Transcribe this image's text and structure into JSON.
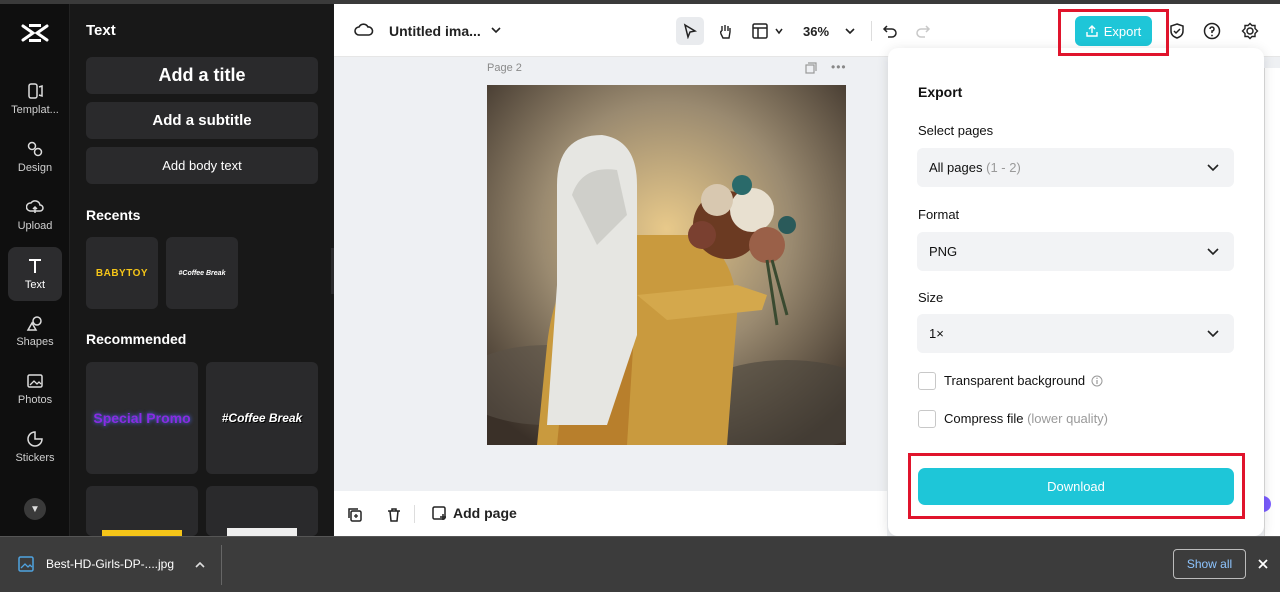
{
  "sidebar": {
    "items": [
      {
        "label": "Templat...",
        "icon": "template-icon"
      },
      {
        "label": "Design",
        "icon": "design-icon"
      },
      {
        "label": "Upload",
        "icon": "upload-icon"
      },
      {
        "label": "Text",
        "icon": "text-icon",
        "active": true
      },
      {
        "label": "Shapes",
        "icon": "shapes-icon"
      },
      {
        "label": "Photos",
        "icon": "photos-icon"
      },
      {
        "label": "Stickers",
        "icon": "stickers-icon"
      }
    ]
  },
  "panel": {
    "title": "Text",
    "add_title": "Add a title",
    "add_subtitle": "Add a subtitle",
    "add_body": "Add body text",
    "recents_label": "Recents",
    "recents": [
      "BABYTOY",
      "#Coffee Break"
    ],
    "recommended_label": "Recommended",
    "recommended": [
      "Special Promo",
      "#Coffee Break"
    ]
  },
  "toolbar": {
    "doc_title": "Untitled ima...",
    "zoom": "36%",
    "export_label": "Export"
  },
  "canvas": {
    "page_label": "Page 2"
  },
  "bottom": {
    "add_page": "Add page"
  },
  "export_panel": {
    "title": "Export",
    "select_pages_label": "Select pages",
    "select_pages_value": "All pages",
    "select_pages_range": "(1 - 2)",
    "format_label": "Format",
    "format_value": "PNG",
    "size_label": "Size",
    "size_value": "1×",
    "transparent_label": "Transparent background",
    "compress_label": "Compress file",
    "compress_note": "(lower quality)",
    "download_label": "Download"
  },
  "download_bar": {
    "filename": "Best-HD-Girls-DP-....jpg",
    "show_all": "Show all"
  },
  "colors": {
    "accent": "#1ec6d8",
    "highlight": "#e0142c"
  }
}
